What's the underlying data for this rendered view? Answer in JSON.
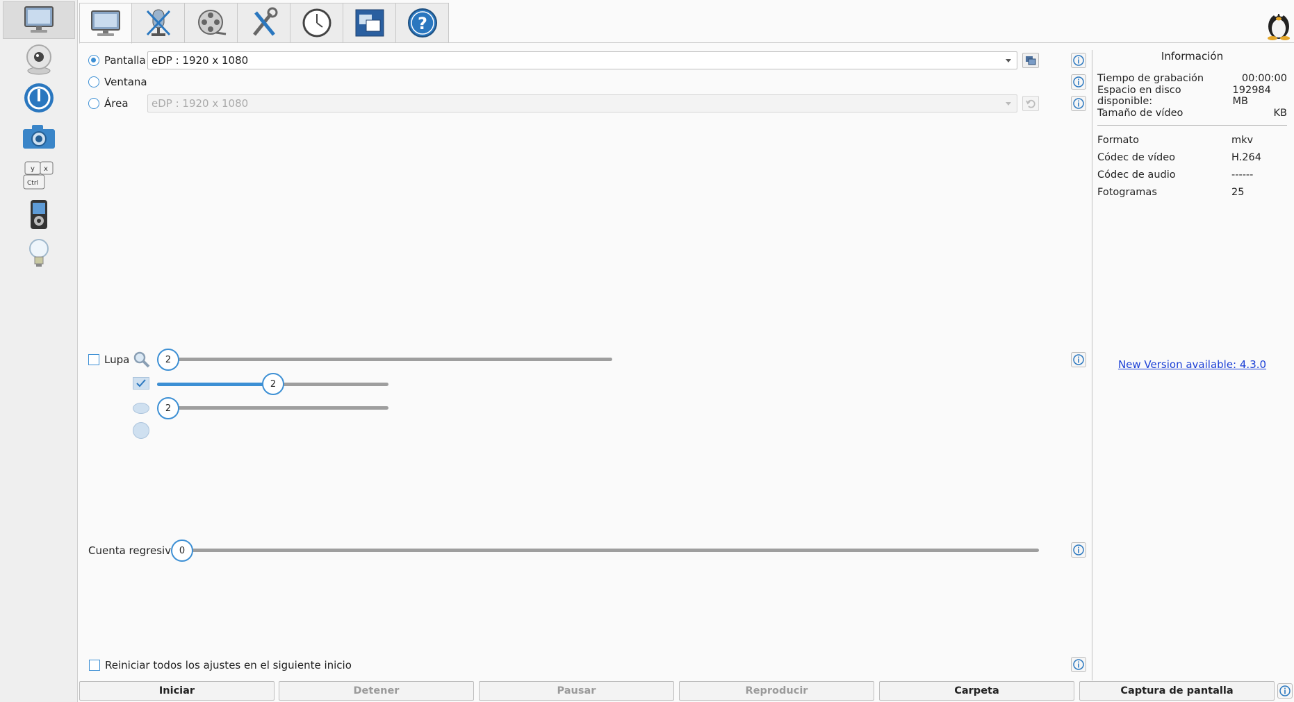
{
  "sidebar": {
    "items": [
      {
        "icon": "monitor-icon",
        "active": true
      },
      {
        "icon": "webcam-icon"
      },
      {
        "icon": "power-icon"
      },
      {
        "icon": "camera-icon"
      },
      {
        "icon": "keyboard-keys-icon"
      },
      {
        "icon": "media-player-icon"
      },
      {
        "icon": "light-bulb-icon"
      }
    ]
  },
  "tabs": [
    {
      "icon": "monitor-icon",
      "active": true
    },
    {
      "icon": "microphone-muted-icon"
    },
    {
      "icon": "film-reel-icon"
    },
    {
      "icon": "tools-icon"
    },
    {
      "icon": "clock-icon"
    },
    {
      "icon": "windows-icon"
    },
    {
      "icon": "help-icon"
    }
  ],
  "screen_options": {
    "pantalla_label": "Pantalla",
    "pantalla_value": "eDP :  1920 x 1080",
    "ventana_label": "Ventana",
    "area_label": "Área",
    "area_value": "eDP :  1920 x 1080"
  },
  "magnifier": {
    "label": "Lupa",
    "slider1_value": "2",
    "slider2_value": "2",
    "slider2_fraction": 0.5,
    "slider3_value": "2"
  },
  "countdown": {
    "label": "Cuenta regresiva",
    "value": "0"
  },
  "reset_label": "Reiniciar todos los ajustes en el siguiente inicio",
  "info": {
    "title": "Información",
    "record_time_label": "Tiempo de grabación",
    "record_time_value": "00:00:00",
    "disk_label": "Espacio en disco disponible:",
    "disk_value": "192984",
    "disk_unit": "MB",
    "video_size_label": "Tamaño de vídeo",
    "video_size_unit": "KB",
    "format_label": "Formato",
    "format_value": "mkv",
    "video_codec_label": "Códec de vídeo",
    "video_codec_value": "H.264",
    "audio_codec_label": "Códec de audio",
    "audio_codec_value": "------",
    "fps_label": "Fotogramas",
    "fps_value": "25"
  },
  "new_version": "New Version available: 4.3.0",
  "buttons": {
    "start": "Iniciar",
    "stop": "Detener",
    "pause": "Pausar",
    "play": "Reproducir",
    "folder": "Carpeta",
    "screenshot": "Captura de pantalla"
  },
  "colors": {
    "accent": "#3c8fd4",
    "link": "#1a3fd6"
  }
}
